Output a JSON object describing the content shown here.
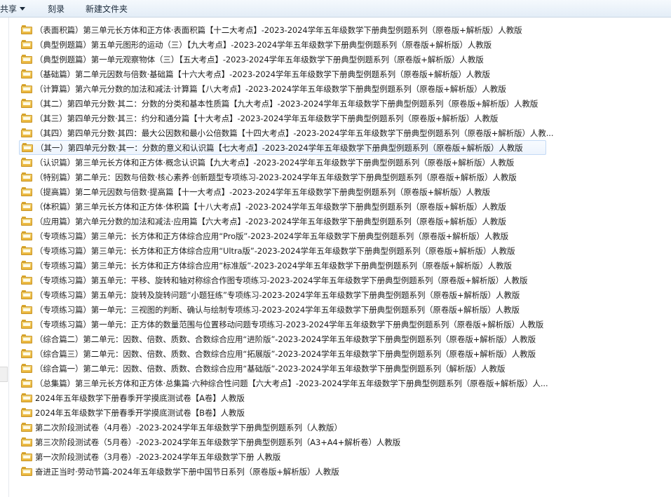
{
  "toolbar": {
    "share_label": "共享",
    "burn_label": "刻录",
    "new_folder_label": "新建文件夹"
  },
  "files": [
    "（表面积篇）第三单元长方体和正方体·表面积篇【十二大考点】-2023-2024学年五年级数学下册典型例题系列（原卷版+解析版）人教版",
    "（典型例题篇）第五单元图形的运动（三）【九大考点】-2023-2024学年五年级数学下册典型例题系列（原卷版+解析版）人教版",
    "（典型例题篇）第一单元观察物体（三）【五大考点】-2023-2024学年五年级数学下册典型例题系列（原卷版+解析版）人教版",
    "（基础篇）第二单元因数与倍数·基础篇【十六大考点】-2023-2024学年五年级数学下册典型例题系列（原卷版+解析版）人教版",
    "（计算篇）第六单元分数的加法和减法·计算篇【八大考点】-2023-2024学年五年级数学下册典型例题系列（原卷版+解析版）人教版",
    "（其二）第四单元分数·其二：分数的分类和基本性质篇【九大考点】-2023-2024学年五年级数学下册典型例题系列（原卷版+解析版）人教版",
    "（其三）第四单元分数·其三：约分和通分篇【十大考点】-2023-2024学年五年级数学下册典型例题系列（原卷版+解析版）人教版",
    "（其四）第四单元分数·其四：最大公因数和最小公倍数篇【十四大考点】-2023-2024学年五年级数学下册典型例题系列（原卷版+解析版）人教...",
    "（其一）第四单元分数·其一：分数的意义和认识篇【七大考点】-2023-2024学年五年级数学下册典型例题系列（原卷版+解析版）人教版",
    "（认识篇）第三单元长方体和正方体·概念认识篇【九大考点】-2023-2024学年五年级数学下册典型例题系列（原卷版+解析版）人教版",
    "（特别篇）第二单元：因数与倍数·核心素养·创新题型专项练习-2023-2024学年五年级数学下册典型例题系列（原卷版+解析版）人教版",
    "（提高篇）第二单元因数与倍数·提高篇【十一大考点】-2023-2024学年五年级数学下册典型例题系列（原卷版+解析版）人教版",
    "（体积篇）第三单元长方体和正方体·体积篇【十八大考点】-2023-2024学年五年级数学下册典型例题系列（原卷版+解析版）人教版",
    "（应用篇）第六单元分数的加法和减法·应用篇【六大考点】-2023-2024学年五年级数学下册典型例题系列（原卷版+解析版）人教版",
    "（专项练习篇）第三单元：长方体和正方体综合应用“Pro版”-2023-2024学年五年级数学下册典型例题系列（原卷版+解析版）人教版",
    "（专项练习篇）第三单元：长方体和正方体综合应用“Ultra版”-2023-2024学年五年级数学下册典型例题系列（原卷版+解析版）人教版",
    "（专项练习篇）第三单元：长方体和正方体综合应用“标准版”-2023-2024学年五年级数学下册典型例题系列（原卷版+解析版）人教版",
    "（专项练习篇）第五单元：平移、旋转和轴对称综合作图专项练习-2023-2024学年五年级数学下册典型例题系列（原卷版+解析版）人教版",
    "（专项练习篇）第五单元：旋转及旋转问题“小题狂练”专项练习-2023-2024学年五年级数学下册典型例题系列（原卷版+解析版）人教版",
    "（专项练习篇）第一单元：三视图的判断、确认与绘制专项练习-2023-2024学年五年级数学下册典型例题系列（原卷版+解析版）人教版",
    "（专项练习篇）第一单元：正方体的数量范围与位置移动问题专项练习-2023-2024学年五年级数学下册典型例题系列（原卷版+解析版）人教版",
    "（综合篇二）第二单元：因数、倍数、质数、合数综合应用“进阶版”-2023-2024学年五年级数学下册典型例题系列（原卷版+解析版）人教版",
    "（综合篇三）第二单元：因数、倍数、质数、合数综合应用“拓展版”-2023-2024学年五年级数学下册典型例题系列（原卷版+解析版）人教版",
    "（综合篇一）第二单元：因数、倍数、质数、合数综合应用“基础版”-2023-2024学年五年级数学下册典型例题系列（解析版）人教版",
    "（总集篇）第三单元长方体和正方体·总集篇·六种综合性问题【六大考点】-2023-2024学年五年级数学下册典型例题系列（原卷版+解析版）人...",
    "2024年五年级数学下册春季开学摸底测试卷【A卷】人教版",
    "2024年五年级数学下册春季开学摸底测试卷【B卷】人教版",
    "第二次阶段测试卷（4月卷）-2023-2024学年五年级数学下册典型例题系列（人教版）",
    "第三次阶段测试卷（5月卷）-2023-2024学年五年级数学下册典型例题系列（A3+A4+解析卷）人教版",
    "第一次阶段测试卷（3月卷）-2023-2024学年五年级数学下册 人教版",
    "奋进正当时·劳动节篇-2024年五年级数学下册中国节日系列（原卷版+解析版）人教版"
  ],
  "selected_index": 8,
  "colors": {
    "folder_fill": "#f0c450",
    "selection_border": "#c3daf5",
    "toolbar_bg": "#e3edf7"
  }
}
